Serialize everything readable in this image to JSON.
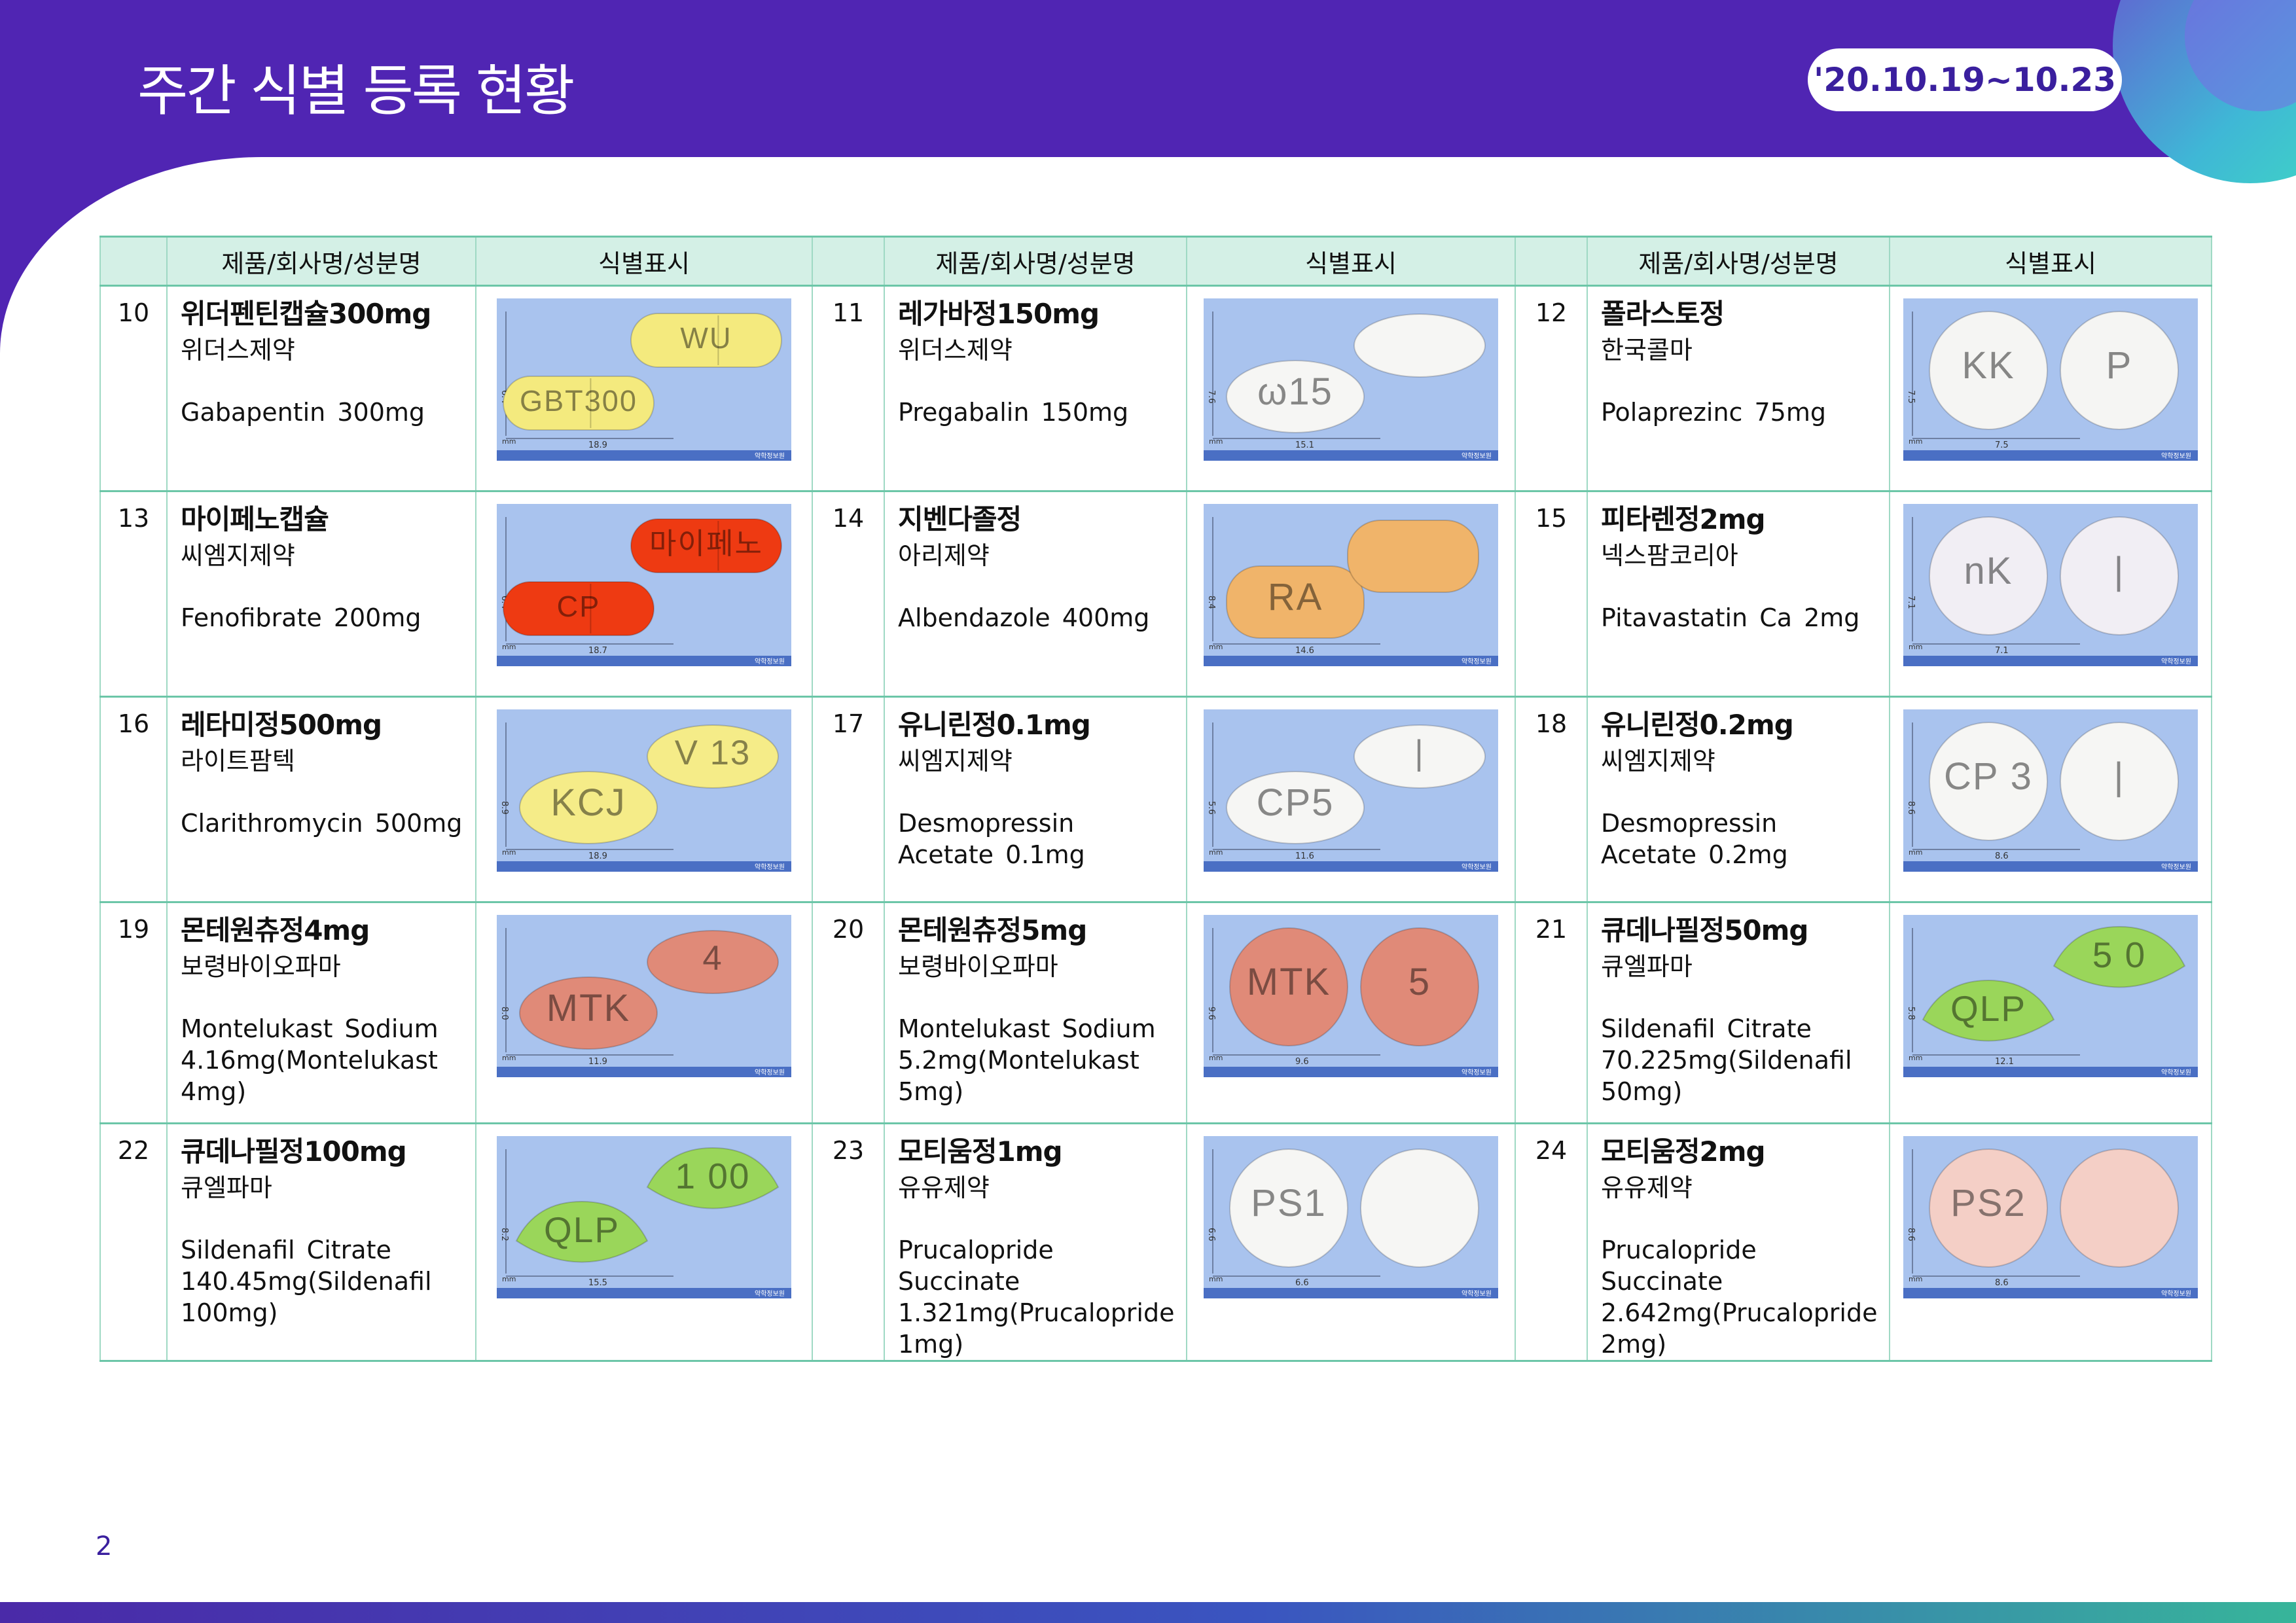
{
  "header": {
    "title": "주간 식별 등록 현황",
    "date_range": "'20.10.19~10.23"
  },
  "table": {
    "columns": [
      "",
      "제품/회사명/성분명",
      "식별표시",
      "",
      "제품/회사명/성분명",
      "식별표시",
      "",
      "제품/회사명/성분명",
      "식별표시"
    ],
    "rows": [
      [
        {
          "no": "10",
          "name": "위더펜틴캡슐300mg",
          "company": "위더스제약",
          "ingredient": "Gabapentin 300mg",
          "photo": {
            "shape": "capsule",
            "color": "#f4ea7e",
            "marks": [
              "GBT300",
              "WU"
            ],
            "width": "18.9",
            "height": "6.4"
          }
        },
        {
          "no": "11",
          "name": "레가바정150mg",
          "company": "위더스제약",
          "ingredient": "Pregabalin 150mg",
          "photo": {
            "shape": "oval",
            "color": "#f6f6f4",
            "marks": [
              "ω15",
              ""
            ],
            "width": "15.1",
            "height": "7.6"
          }
        },
        {
          "no": "12",
          "name": "폴라스토정",
          "company": "한국콜마",
          "ingredient": "Polaprezinc 75mg",
          "photo": {
            "shape": "round",
            "color": "#f5f5f3",
            "marks": [
              "KK",
              "P"
            ],
            "width": "7.5",
            "height": "7.5"
          }
        }
      ],
      [
        {
          "no": "13",
          "name": "마이페노캡슐",
          "company": "씨엠지제약",
          "ingredient": "Fenofibrate 200mg",
          "photo": {
            "shape": "capsule",
            "color": "#ee3a12",
            "marks": [
              "CP",
              "마이페노"
            ],
            "width": "18.7",
            "height": "6.4"
          }
        },
        {
          "no": "14",
          "name": "지벤다졸정",
          "company": "아리제약",
          "ingredient": "Albendazole 400mg",
          "photo": {
            "shape": "oblong",
            "color": "#f0b46a",
            "marks": [
              "RA",
              ""
            ],
            "width": "14.6",
            "height": "8.4"
          }
        },
        {
          "no": "15",
          "name": "피타렌정2mg",
          "company": "넥스팜코리아",
          "ingredient": "Pitavastatin Ca 2mg",
          "photo": {
            "shape": "round",
            "color": "#f1eef4",
            "marks": [
              "nK",
              "|"
            ],
            "width": "7.1",
            "height": "7.1"
          }
        }
      ],
      [
        {
          "no": "16",
          "name": "레타미정500mg",
          "company": "라이트팜텍",
          "ingredient": "Clarithromycin 500mg",
          "photo": {
            "shape": "oval",
            "color": "#f5ec88",
            "marks": [
              "KCJ",
              "V 13"
            ],
            "width": "18.9",
            "height": "8.9"
          }
        },
        {
          "no": "17",
          "name": "유니린정0.1mg",
          "company": "씨엠지제약",
          "ingredient": "Desmopressin Acetate 0.1mg",
          "photo": {
            "shape": "oval",
            "color": "#f6f6f4",
            "marks": [
              "CP5",
              "|"
            ],
            "width": "11.6",
            "height": "5.6"
          }
        },
        {
          "no": "18",
          "name": "유니린정0.2mg",
          "company": "씨엠지제약",
          "ingredient": "Desmopressin Acetate 0.2mg",
          "photo": {
            "shape": "round",
            "color": "#f6f6f4",
            "marks": [
              "CP 3",
              "|"
            ],
            "width": "8.6",
            "height": "8.6"
          }
        }
      ],
      [
        {
          "no": "19",
          "name": "몬테원츄정4mg",
          "company": "보령바이오파마",
          "ingredient": "Montelukast Sodium 4.16mg(Montelukast 4mg)",
          "photo": {
            "shape": "oval",
            "color": "#e08a78",
            "marks": [
              "MTK",
              "4"
            ],
            "width": "11.9",
            "height": "8.0"
          }
        },
        {
          "no": "20",
          "name": "몬테원츄정5mg",
          "company": "보령바이오파마",
          "ingredient": "Montelukast Sodium 5.2mg(Montelukast 5mg)",
          "photo": {
            "shape": "round",
            "color": "#e08a78",
            "marks": [
              "MTK",
              "5"
            ],
            "width": "9.6",
            "height": "9.6"
          }
        },
        {
          "no": "21",
          "name": "큐데나필정50mg",
          "company": "큐엘파마",
          "ingredient": "Sildenafil Citrate 70.225mg(Sildenafil 50mg)",
          "photo": {
            "shape": "triangle",
            "color": "#9ad65a",
            "marks": [
              "QLP",
              "5 0"
            ],
            "width": "12.1",
            "height": "5.8"
          }
        }
      ],
      [
        {
          "no": "22",
          "name": "큐데나필정100mg",
          "company": "큐엘파마",
          "ingredient": "Sildenafil Citrate 140.45mg(Sildenafil 100mg)",
          "photo": {
            "shape": "triangle",
            "color": "#9ad65a",
            "marks": [
              "QLP",
              "1 00"
            ],
            "width": "15.5",
            "height": "8.2"
          }
        },
        {
          "no": "23",
          "name": "모티움정1mg",
          "company": "유유제약",
          "ingredient": "Prucalopride Succinate 1.321mg(Prucalopride 1mg)",
          "photo": {
            "shape": "round",
            "color": "#f6f6f4",
            "marks": [
              "PS1",
              ""
            ],
            "width": "6.6",
            "height": "6.6"
          }
        },
        {
          "no": "24",
          "name": "모티움정2mg",
          "company": "유유제약",
          "ingredient": "Prucalopride Succinate 2.642mg(Prucalopride 2mg)",
          "photo": {
            "shape": "round",
            "color": "#f4cfc6",
            "marks": [
              "PS2",
              ""
            ],
            "width": "8.6",
            "height": "8.6"
          }
        }
      ]
    ]
  },
  "page_number": "2",
  "colors": {
    "brand_purple": "#5025b3",
    "table_header_bg": "#d4f0e6",
    "table_border": "#6cc6a8",
    "photo_bg": "#a9c3ee"
  }
}
